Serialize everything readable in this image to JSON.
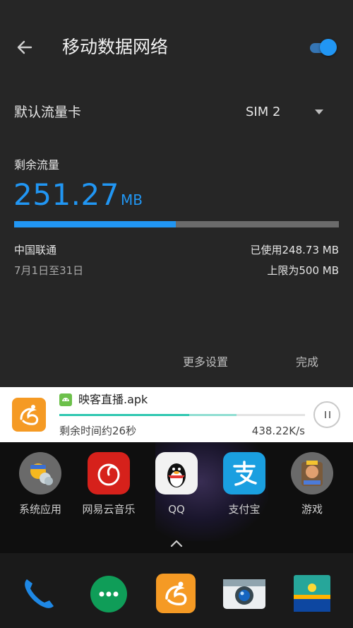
{
  "header": {
    "title": "移动数据网络",
    "toggle_on": true,
    "accent_color": "#2196f3"
  },
  "default_card": {
    "label": "默认流量卡",
    "selected": "SIM 2"
  },
  "usage": {
    "remaining_label": "剩余流量",
    "remaining_value": "251.27",
    "remaining_unit": "MB",
    "used_fraction": 0.497,
    "carrier": "中国联通",
    "period": "7月1日至31日",
    "used_text": "已使用248.73 MB",
    "limit_text": "上限为500 MB"
  },
  "actions": {
    "more_label": "更多设置",
    "done_label": "完成"
  },
  "notification": {
    "file_name": "映客直播.apk",
    "time_left": "剩余时间约26秒",
    "speed": "438.22K/s",
    "progress": 0.53,
    "buffered": 0.72
  },
  "home": {
    "apps": [
      {
        "label": "系统应用",
        "icon": "system-apps-folder-icon"
      },
      {
        "label": "网易云音乐",
        "icon": "netease-music-icon"
      },
      {
        "label": "QQ",
        "icon": "qq-penguin-icon"
      },
      {
        "label": "支付宝",
        "icon": "alipay-icon"
      },
      {
        "label": "游戏",
        "icon": "games-folder-icon"
      }
    ],
    "dock": [
      "phone-icon",
      "hangouts-icon",
      "uc-browser-icon",
      "camera-icon",
      "gallery-icon"
    ]
  }
}
